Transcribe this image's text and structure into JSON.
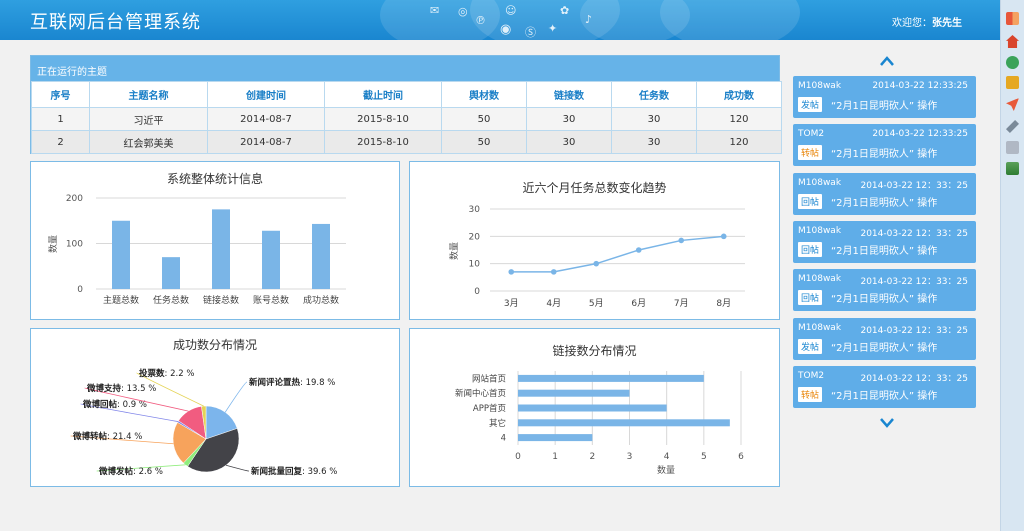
{
  "header": {
    "title": "互联网后台管理系统",
    "welcome_prefix": "欢迎您：",
    "user": "张先生"
  },
  "topics": {
    "title": "正在运行的主题",
    "columns": [
      "序号",
      "主题名称",
      "创建时间",
      "截止时间",
      "舆材数",
      "链接数",
      "任务数",
      "成功数"
    ],
    "rows": [
      [
        "1",
        "习近平",
        "2014-08-7",
        "2015-8-10",
        "50",
        "30",
        "30",
        "120"
      ],
      [
        "2",
        "红会郭美美",
        "2014-08-7",
        "2015-8-10",
        "50",
        "30",
        "30",
        "120"
      ]
    ]
  },
  "stats_chart": {
    "title": "系统整体统计信息",
    "ylabel": "数量",
    "chart_data": {
      "type": "bar",
      "categories": [
        "主题总数",
        "任务总数",
        "链接总数",
        "账号总数",
        "成功总数"
      ],
      "values": [
        150,
        70,
        175,
        128,
        143
      ],
      "ylim": [
        0,
        200
      ],
      "yticks": [
        "0",
        "100",
        "200"
      ],
      "color": "#7ab5e7"
    }
  },
  "trend_chart": {
    "title": "近六个月任务总数变化趋势",
    "ylabel": "数量",
    "chart_data": {
      "type": "line",
      "categories": [
        "3月",
        "4月",
        "5月",
        "6月",
        "7月",
        "8月"
      ],
      "values": [
        7,
        7,
        10,
        15,
        18.5,
        20
      ],
      "ylim": [
        0,
        30
      ],
      "yticks": [
        "0",
        "10",
        "20",
        "30"
      ],
      "color": "#7ab5e7"
    }
  },
  "success_chart": {
    "title": "成功数分布情况",
    "chart_data": {
      "type": "pie",
      "slices": [
        {
          "label": "新闻评论置热",
          "pct": "19.8 %",
          "value": 19.8,
          "color": "#7cb5ec"
        },
        {
          "label": "新闻批量回复",
          "pct": "39.6 %",
          "value": 39.6,
          "color": "#434348"
        },
        {
          "label": "微博发帖",
          "pct": "2.6 %",
          "value": 2.6,
          "color": "#90ed7d"
        },
        {
          "label": "微博转帖",
          "pct": "21.4 %",
          "value": 21.4,
          "color": "#f7a35c"
        },
        {
          "label": "微博回帖",
          "pct": "0.9 %",
          "value": 0.9,
          "color": "#8085e9"
        },
        {
          "label": "微博支持",
          "pct": "13.5 %",
          "value": 13.5,
          "color": "#f15c80"
        },
        {
          "label": "投票数",
          "pct": "2.2 %",
          "value": 2.2,
          "color": "#e4d354"
        }
      ]
    }
  },
  "links_chart": {
    "title": "链接数分布情况",
    "xlabel": "数量",
    "chart_data": {
      "type": "bar",
      "orientation": "horizontal",
      "categories": [
        "网站首页",
        "新闻中心首页",
        "APP首页",
        "其它",
        "4"
      ],
      "values": [
        5,
        3,
        4,
        5.7,
        2
      ],
      "xlim": [
        0,
        6
      ],
      "xticks": [
        "0",
        "1",
        "2",
        "3",
        "4",
        "5",
        "6"
      ],
      "color": "#7ab5e7"
    }
  },
  "feed": [
    {
      "user": "M108wak",
      "time": "2014-03-22  12:33:25",
      "type": "发帖",
      "badge": "blue",
      "msg": "“2月1日昆明砍人”  操作"
    },
    {
      "user": "TOM2",
      "time": "2014-03-22  12:33:25",
      "type": "转帖",
      "badge": "orange",
      "msg": "“2月1日昆明砍人”  操作"
    },
    {
      "user": "M108wak",
      "time": "2014-03-22  12：33：25",
      "type": "回帖",
      "badge": "blue",
      "msg": "“2月1日昆明砍人”  操作"
    },
    {
      "user": "M108wak",
      "time": "2014-03-22  12：33：25",
      "type": "回帖",
      "badge": "blue",
      "msg": "“2月1日昆明砍人”  操作"
    },
    {
      "user": "M108wak",
      "time": "2014-03-22  12：33：25",
      "type": "回帖",
      "badge": "blue",
      "msg": "“2月1日昆明砍人”  操作"
    },
    {
      "user": "M108wak",
      "time": "2014-03-22  12：33：25",
      "type": "发帖",
      "badge": "blue",
      "msg": "“2月1日昆明砍人”  操作"
    },
    {
      "user": "TOM2",
      "time": "2014-03-22  12：33：25",
      "type": "转帖",
      "badge": "orange",
      "msg": "“2月1日昆明砍人”  操作"
    }
  ],
  "rightbar_icons": [
    "logout-icon",
    "home-icon",
    "globe-icon",
    "lock-icon",
    "rocket-icon",
    "tools-icon",
    "document-icon",
    "chart-icon"
  ]
}
